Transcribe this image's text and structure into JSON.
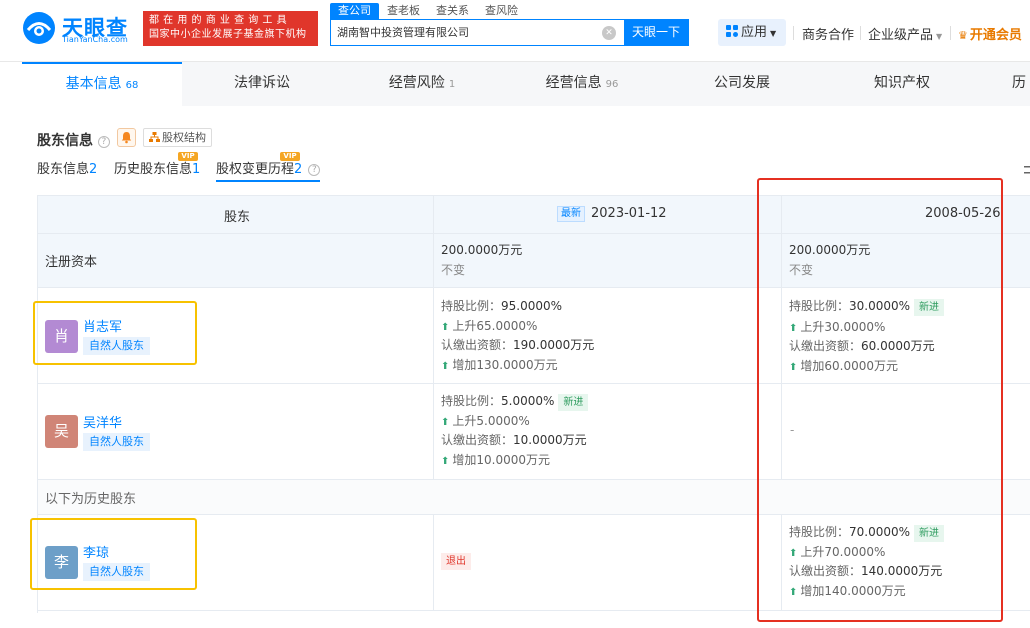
{
  "header": {
    "logo_cn": "天眼查",
    "logo_en": "TianYanCha.com",
    "banner_line1": "都 在 用 的 商 业 查 询 工 具",
    "banner_line2": "国家中小企业发展子基金旗下机构",
    "search_tabs": [
      "查公司",
      "查老板",
      "查关系",
      "查风险"
    ],
    "search_value": "湖南智中投资管理有限公司",
    "search_button": "天眼一下",
    "app_button": "应用",
    "nav_business": "商务合作",
    "nav_enterprise": "企业级产品",
    "nav_vip": "开通会员"
  },
  "tabs": [
    {
      "label": "基本信息",
      "count": "68"
    },
    {
      "label": "法律诉讼",
      "count": ""
    },
    {
      "label": "经营风险",
      "count": "1"
    },
    {
      "label": "经营信息",
      "count": "96"
    },
    {
      "label": "公司发展",
      "count": ""
    },
    {
      "label": "知识产权",
      "count": ""
    },
    {
      "label": "历",
      "count": ""
    }
  ],
  "section": {
    "title": "股东信息",
    "equity_button": "股权结构"
  },
  "subtabs": [
    {
      "label": "股东信息",
      "count": "2",
      "vip": ""
    },
    {
      "label": "历史股东信息",
      "count": "1",
      "vip": "VIP"
    },
    {
      "label": "股权变更历程",
      "count": "2",
      "vip": "VIP"
    }
  ],
  "table": {
    "header_shareholder": "股东",
    "latest_tag": "最新",
    "date1": "2023-01-12",
    "date2": "2008-05-26",
    "capital_label": "注册资本",
    "capital1": "200.0000万元",
    "capital1_change": "不变",
    "capital2": "200.0000万元",
    "capital2_change": "不变",
    "history_label": "以下为历史股东",
    "rows": [
      {
        "avatar": "肖",
        "name": "肖志军",
        "type": "自然人股东",
        "col1": {
          "ratio_k": "持股比例：",
          "ratio_v": "95.0000%",
          "ratio_change": "上升65.0000%",
          "amount_k": "认缴出资额：",
          "amount_v": "190.0000万元",
          "amount_change": "增加130.0000万元"
        },
        "col2": {
          "ratio_k": "持股比例：",
          "ratio_v": "30.0000%",
          "tag": "新进",
          "ratio_change": "上升30.0000%",
          "amount_k": "认缴出资额：",
          "amount_v": "60.0000万元",
          "amount_change": "增加60.0000万元"
        }
      },
      {
        "avatar": "吴",
        "name": "吴洋华",
        "type": "自然人股东",
        "col1": {
          "ratio_k": "持股比例：",
          "ratio_v": "5.0000%",
          "tag": "新进",
          "ratio_change": "上升5.0000%",
          "amount_k": "认缴出资额：",
          "amount_v": "10.0000万元",
          "amount_change": "增加10.0000万元"
        },
        "col2_empty": "-"
      },
      {
        "avatar": "李",
        "name": "李琼",
        "type": "自然人股东",
        "col1_exit": "退出",
        "col2": {
          "ratio_k": "持股比例：",
          "ratio_v": "70.0000%",
          "tag": "新进",
          "ratio_change": "上升70.0000%",
          "amount_k": "认缴出资额：",
          "amount_v": "140.0000万元",
          "amount_change": "增加140.0000万元"
        }
      }
    ]
  },
  "colors": {
    "brand": "#0084ff",
    "banner_red": "#e0362b",
    "highlight_yellow": "#f7c200",
    "highlight_red": "#e53021",
    "up_green": "#33a877"
  }
}
